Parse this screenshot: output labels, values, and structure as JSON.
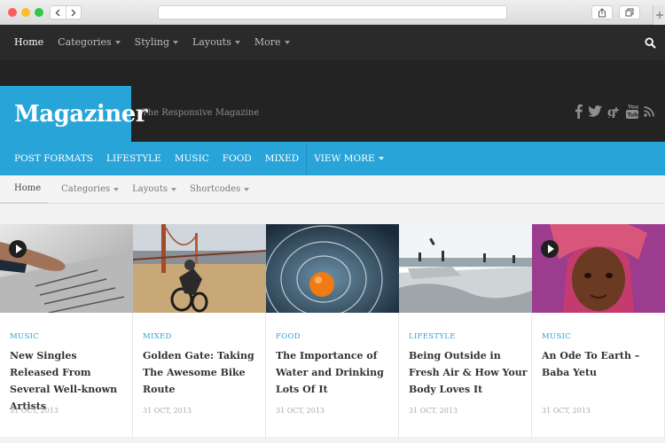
{
  "browser": {
    "back": "<",
    "forward": ">"
  },
  "topnav": {
    "items": [
      {
        "label": "Home",
        "active": true
      },
      {
        "label": "Categories",
        "caret": true
      },
      {
        "label": "Styling",
        "caret": true
      },
      {
        "label": "Layouts",
        "caret": true
      },
      {
        "label": "More",
        "caret": true
      }
    ],
    "search_icon": "search-icon"
  },
  "header": {
    "logo": "Magaziner",
    "tagline": "The Responsive Magazine",
    "social_icons": [
      "facebook-icon",
      "twitter-icon",
      "google-plus-icon",
      "youtube-icon",
      "rss-icon"
    ]
  },
  "bluenav": {
    "items": [
      "POST FORMATS",
      "LIFESTYLE",
      "MUSIC",
      "FOOD",
      "MIXED"
    ],
    "more": "VIEW MORE"
  },
  "subnav": {
    "items": [
      "Home",
      "Categories",
      "Layouts",
      "Shortcodes"
    ]
  },
  "colors": {
    "accent": "#29a4d9",
    "dark": "#232323"
  },
  "cards": [
    {
      "category": "MUSIC",
      "title": "New Singles Released From Several Well-known Artists",
      "date": "31 OCT, 2013",
      "has_play": true
    },
    {
      "category": "MIXED",
      "title": "Golden Gate: Taking The Awesome Bike Route",
      "date": "31 OCT, 2013",
      "has_play": false
    },
    {
      "category": "FOOD",
      "title": "The Importance of Water and Drinking Lots Of It",
      "date": "31 OCT, 2013",
      "has_play": false
    },
    {
      "category": "LIFESTYLE",
      "title": "Being Outside in Fresh Air & How Your Body Loves It",
      "date": "31 OCT, 2013",
      "has_play": false
    },
    {
      "category": "MUSIC",
      "title": "An Ode To Earth – Baba Yetu",
      "date": "31 OCT, 2013",
      "has_play": true
    }
  ]
}
